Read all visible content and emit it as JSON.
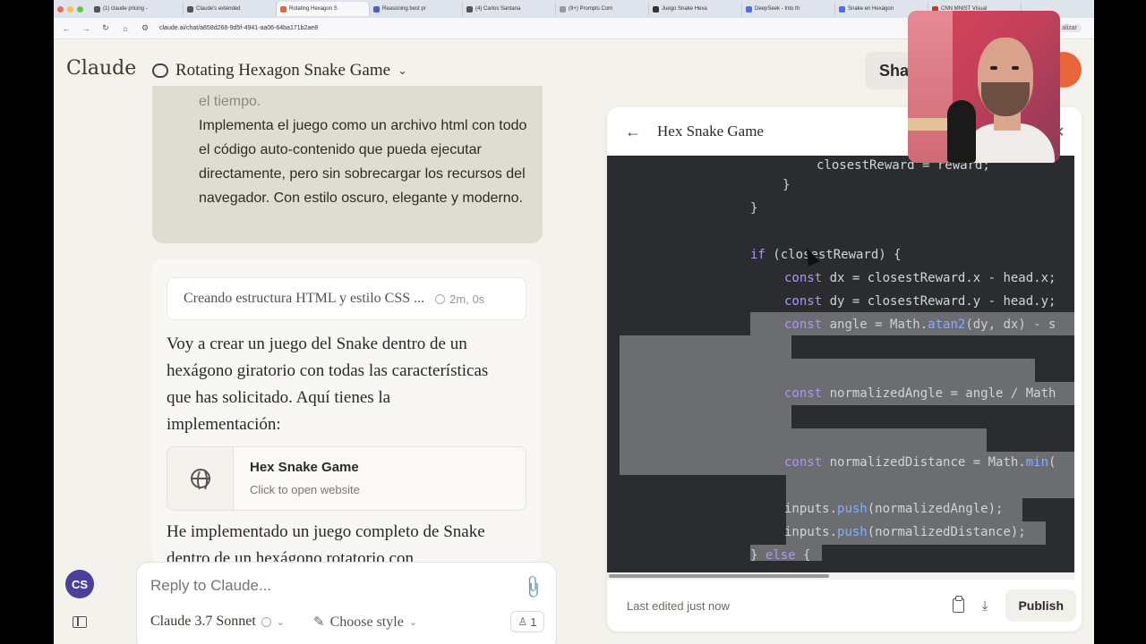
{
  "browser": {
    "tabs": [
      {
        "label": "(1) claude pricing -"
      },
      {
        "label": "Claude's extended"
      },
      {
        "label": "Rotating Hexagon S"
      },
      {
        "label": "Reasoning best pr"
      },
      {
        "label": "(4) Carlos Santana"
      },
      {
        "label": "(9+) Prompts Com"
      },
      {
        "label": "Juego Snake Hexa"
      },
      {
        "label": "DeepSeek - Into th"
      },
      {
        "label": "Snake en Hexágon"
      },
      {
        "label": "CNN MNIST Visual"
      }
    ],
    "url": "claude.ai/chat/a858d268-9d5f-4941-aa06-64ba171b2ae8",
    "right_label": "alizar"
  },
  "header": {
    "brand": "Claude",
    "chat_title": "Rotating Hexagon Snake Game",
    "share_label": "Share"
  },
  "user_message": {
    "fade_line": "el tiempo.",
    "text": "Implementa el juego como un archivo html con todo el código auto-contenido que pueda ejecutar directamente, pero sin sobrecargar los recursos del navegador. Con estilo oscuro, elegante y moderno."
  },
  "assistant": {
    "thinking_label": "Creando estructura HTML y estilo CSS ...",
    "thinking_time": "2m, 0s",
    "paragraph1": "Voy a crear un juego del Snake dentro de un hexágono giratorio con todas las características que has solicitado. Aquí tienes la implementación:",
    "artifact_title": "Hex Snake Game",
    "artifact_subtitle": "Click to open website",
    "paragraph2": "He implementado un juego completo de Snake dentro de un hexágono rotatorio con"
  },
  "user": {
    "initials": "CS"
  },
  "composer": {
    "placeholder": "Reply to Claude...",
    "model": "Claude 3.7 Sonnet",
    "style": "Choose style",
    "count": "1"
  },
  "panel": {
    "title": "Hex Snake Game",
    "footer_status": "Last edited just now",
    "publish_label": "Publish",
    "code_lines": [
      {
        "text": "closestReward = reward;"
      },
      {
        "text": "}"
      },
      {
        "text": "}"
      },
      {
        "text": "if (closestReward) {"
      },
      {
        "text": "const dx = closestReward.x - head.x;"
      },
      {
        "text": "const dy = closestReward.y - head.y;"
      },
      {
        "text": "const angle = Math.atan2(dy, dx) - s"
      },
      {
        "text": "const normalizedAngle = angle / Math"
      },
      {
        "text": "const normalizedDistance = Math.min("
      },
      {
        "text": "inputs.push(normalizedAngle);"
      },
      {
        "text": "inputs.push(normalizedDistance);"
      },
      {
        "text": "} else {"
      }
    ]
  },
  "colors": {
    "accent": "#e8643b",
    "code_bg": "#2b2c30",
    "selection": "#6c6d71",
    "keyword": "#b094f5",
    "function": "#7fb0ff"
  }
}
